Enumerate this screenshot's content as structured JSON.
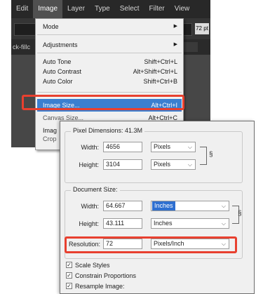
{
  "menubar": {
    "items": [
      "Edit",
      "Image",
      "Layer",
      "Type",
      "Select",
      "Filter",
      "View"
    ],
    "active_index": 1
  },
  "options_bar": {
    "font_size": "72 pt"
  },
  "tab_bar": {
    "left_tab": "ck-fillc",
    "right_tab": ""
  },
  "image_menu": {
    "mode": {
      "label": "Mode"
    },
    "adjustments": {
      "label": "Adjustments"
    },
    "auto_tone": {
      "label": "Auto Tone",
      "shortcut": "Shift+Ctrl+L"
    },
    "auto_contrast": {
      "label": "Auto Contrast",
      "shortcut": "Alt+Shift+Ctrl+L"
    },
    "auto_color": {
      "label": "Auto Color",
      "shortcut": "Shift+Ctrl+B"
    },
    "image_size": {
      "label": "Image Size...",
      "shortcut": "Alt+Ctrl+I"
    },
    "canvas_size": {
      "label": "Canvas Size...",
      "shortcut": "Alt+Ctrl+C"
    },
    "image_rotation": {
      "label": "Imag"
    },
    "crop": {
      "label": "Crop"
    }
  },
  "dialog": {
    "pixel_dimensions": {
      "title": "Pixel Dimensions:  41.3M",
      "width_label": "Width:",
      "width_value": "4656",
      "width_unit": "Pixels",
      "height_label": "Height:",
      "height_value": "3104",
      "height_unit": "Pixels"
    },
    "document_size": {
      "title": "Document Size:",
      "width_label": "Width:",
      "width_value": "64.667",
      "width_unit": "Inches",
      "height_label": "Height:",
      "height_value": "43.111",
      "height_unit": "Inches",
      "resolution_label": "Resolution:",
      "resolution_value": "72",
      "resolution_unit": "Pixels/Inch"
    },
    "checkboxes": {
      "scale_styles": "Scale Styles",
      "constrain_proportions": "Constrain Proportions",
      "resample_image": "Resample Image:"
    }
  },
  "colors": {
    "highlight": "#e8402f",
    "menu_selection": "#3a7fd0",
    "app_dark": "#3c3c3c"
  }
}
